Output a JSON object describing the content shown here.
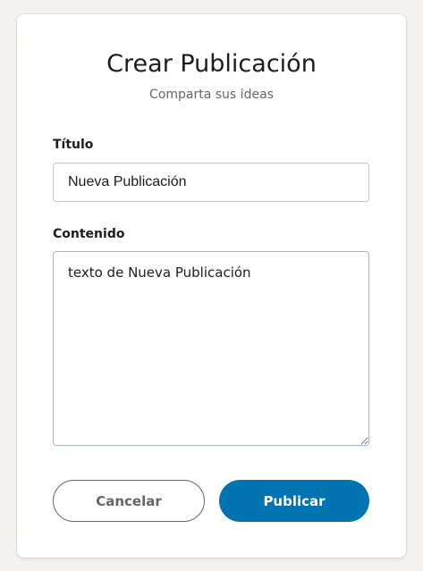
{
  "form": {
    "title": "Crear Publicación",
    "subtitle": "Comparta sus ideas",
    "title_field": {
      "label": "Título",
      "value": "Nueva Publicación"
    },
    "content_field": {
      "label": "Contenido",
      "value": "texto de Nueva Publicación"
    },
    "cancel_label": "Cancelar",
    "publish_label": "Publicar"
  },
  "colors": {
    "primary": "#0073b1",
    "background": "#f3f2ef",
    "card": "#ffffff"
  }
}
